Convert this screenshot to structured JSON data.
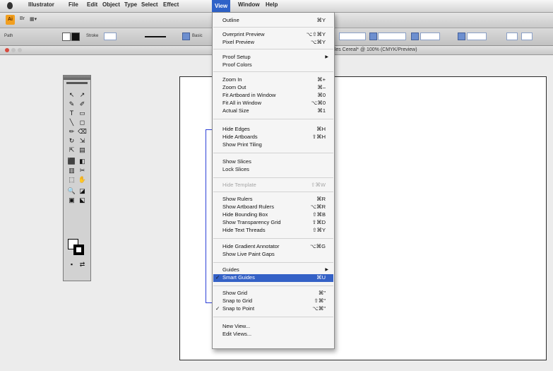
{
  "menubar": {
    "app": "Illustrator",
    "items": [
      "File",
      "Edit",
      "Object",
      "Type",
      "Select",
      "Effect",
      "View",
      "Window",
      "Help"
    ],
    "active": "View"
  },
  "approw": {
    "logo": "Ai",
    "br": "Br",
    "arrange": "▦▾"
  },
  "controlbar": {
    "path_label": "Path",
    "stroke_label": "Stroke",
    "basic_label": "Basic"
  },
  "document": {
    "title": "ffles Cereal* @ 100% (CMYK/Preview)"
  },
  "toolbox": {
    "tools": [
      "↖",
      "↗",
      "✎",
      "✐",
      "T",
      "▭",
      "╲",
      "◻",
      "✏",
      "⌫",
      "↻",
      "⇲",
      "⇱",
      "▤",
      "⬛",
      "◧",
      "▥",
      "✂",
      "⬚",
      "✋",
      "🔍",
      "◪",
      "▣",
      "⬕",
      "▪",
      "⇄"
    ]
  },
  "view_menu": {
    "sections": [
      [
        {
          "label": "Outline",
          "shortcut": "⌘Y"
        }
      ],
      [
        {
          "label": "Overprint Preview",
          "shortcut": "⌥⇧⌘Y"
        },
        {
          "label": "Pixel Preview",
          "shortcut": "⌥⌘Y"
        }
      ],
      [
        {
          "label": "Proof Setup",
          "shortcut": "",
          "submenu": true
        },
        {
          "label": "Proof Colors",
          "shortcut": ""
        }
      ],
      [
        {
          "label": "Zoom In",
          "shortcut": "⌘+"
        },
        {
          "label": "Zoom Out",
          "shortcut": "⌘–"
        },
        {
          "label": "Fit Artboard in Window",
          "shortcut": "⌘0"
        },
        {
          "label": "Fit All in Window",
          "shortcut": "⌥⌘0"
        },
        {
          "label": "Actual Size",
          "shortcut": "⌘1"
        }
      ],
      [
        {
          "label": "Hide Edges",
          "shortcut": "⌘H"
        },
        {
          "label": "Hide Artboards",
          "shortcut": "⇧⌘H"
        },
        {
          "label": "Show Print Tiling",
          "shortcut": ""
        }
      ],
      [
        {
          "label": "Show Slices",
          "shortcut": ""
        },
        {
          "label": "Lock Slices",
          "shortcut": ""
        }
      ],
      [
        {
          "label": "Hide Template",
          "shortcut": "⇧⌘W",
          "disabled": true
        }
      ],
      [
        {
          "label": "Show Rulers",
          "shortcut": "⌘R"
        },
        {
          "label": "Show Artboard Rulers",
          "shortcut": "⌥⌘R"
        },
        {
          "label": "Hide Bounding Box",
          "shortcut": "⇧⌘B"
        },
        {
          "label": "Show Transparency Grid",
          "shortcut": "⇧⌘D"
        },
        {
          "label": "Hide Text Threads",
          "shortcut": "⇧⌘Y"
        }
      ],
      [
        {
          "label": "Hide Gradient Annotator",
          "shortcut": "⌥⌘G"
        },
        {
          "label": "Show Live Paint Gaps",
          "shortcut": ""
        }
      ],
      [
        {
          "label": "Guides",
          "shortcut": "",
          "submenu": true
        },
        {
          "label": "Smart Guides",
          "shortcut": "⌘U",
          "checked": true,
          "highlighted": true
        }
      ],
      [
        {
          "label": "Show Grid",
          "shortcut": "⌘\""
        },
        {
          "label": "Snap to Grid",
          "shortcut": "⇧⌘\""
        },
        {
          "label": "Snap to Point",
          "shortcut": "⌥⌘\"",
          "checked": true
        }
      ],
      [
        {
          "label": "New View...",
          "shortcut": ""
        },
        {
          "label": "Edit Views...",
          "shortcut": ""
        }
      ]
    ]
  }
}
